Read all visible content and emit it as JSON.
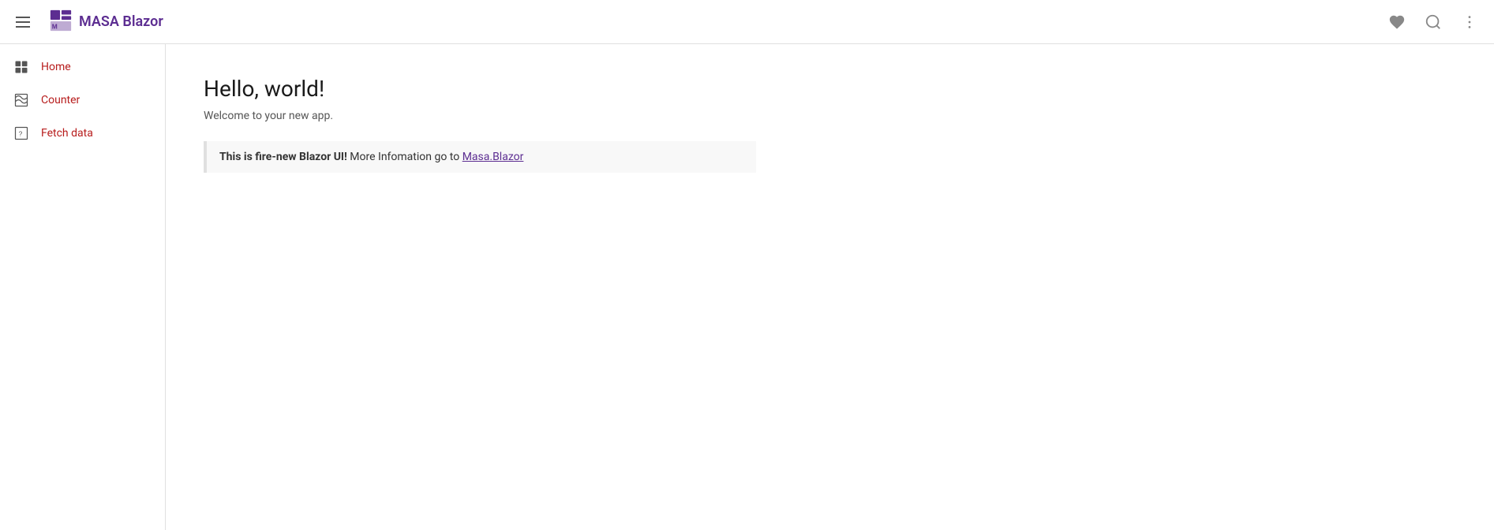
{
  "app": {
    "title": "MASA Blazor",
    "logo_text": "MASA Blazor"
  },
  "topnav": {
    "hamburger_label": "Toggle menu",
    "heart_label": "Favorites",
    "search_label": "Search",
    "more_label": "More options"
  },
  "sidebar": {
    "items": [
      {
        "id": "home",
        "label": "Home",
        "icon": "home-icon"
      },
      {
        "id": "counter",
        "label": "Counter",
        "icon": "counter-icon"
      },
      {
        "id": "fetch-data",
        "label": "Fetch data",
        "icon": "fetch-icon"
      }
    ]
  },
  "content": {
    "title": "Hello, world!",
    "subtitle": "Welcome to your new app.",
    "alert": {
      "bold_part": "This is fire-new Blazor UI!",
      "text_part": " More Infomation go to ",
      "link_text": "Masa.Blazor",
      "link_href": "https://masa.blazor.com"
    }
  }
}
